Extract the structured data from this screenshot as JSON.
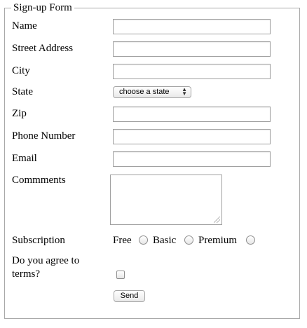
{
  "form": {
    "legend": "Sign-up Form",
    "fields": {
      "name": {
        "label": "Name",
        "value": ""
      },
      "street": {
        "label": "Street Address",
        "value": ""
      },
      "city": {
        "label": "City",
        "value": ""
      },
      "state": {
        "label": "State",
        "selected": "choose a state"
      },
      "zip": {
        "label": "Zip",
        "value": ""
      },
      "phone": {
        "label": "Phone Number",
        "value": ""
      },
      "email": {
        "label": "Email",
        "value": ""
      },
      "comments": {
        "label": "Commments",
        "value": ""
      }
    },
    "subscription": {
      "label": "Subscription",
      "options": [
        "Free",
        "Basic",
        "Premium"
      ]
    },
    "terms": {
      "label_line1": "Do you agree to",
      "label_line2": "terms?",
      "checked": false
    },
    "submit_label": "Send"
  }
}
